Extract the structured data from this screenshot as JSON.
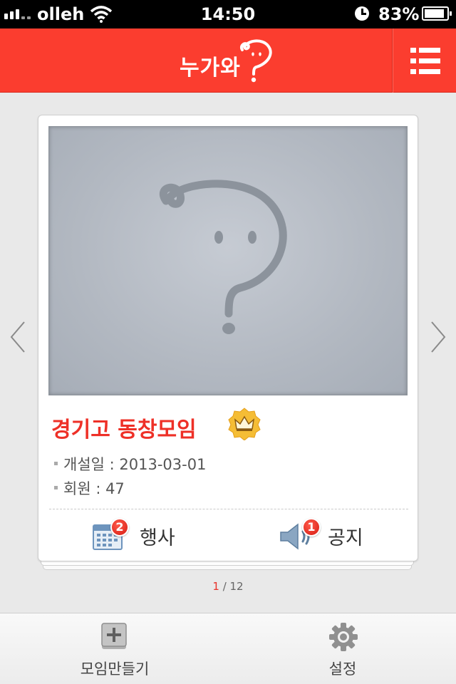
{
  "status_bar": {
    "carrier": "olleh",
    "time": "14:50",
    "battery": "83%"
  },
  "header": {
    "logo_text": "누가와",
    "menu_icon": "list-menu-icon",
    "accent_color": "#fb3d2f"
  },
  "card": {
    "title": "경기고 동창모임",
    "title_color": "#ee3027",
    "badge_icon": "crown-icon",
    "info": [
      "개설일 : 2013-03-01",
      "회원 : 47"
    ],
    "actions": [
      {
        "label": "행사",
        "icon": "calendar-icon",
        "count": "2"
      },
      {
        "label": "공지",
        "icon": "megaphone-icon",
        "count": "1"
      }
    ]
  },
  "pager": {
    "current": "1",
    "separator": " / ",
    "total": "12"
  },
  "tab_bar": {
    "items": [
      {
        "label": "모임만들기",
        "icon": "add-box-icon"
      },
      {
        "label": "설정",
        "icon": "gear-icon"
      }
    ]
  }
}
